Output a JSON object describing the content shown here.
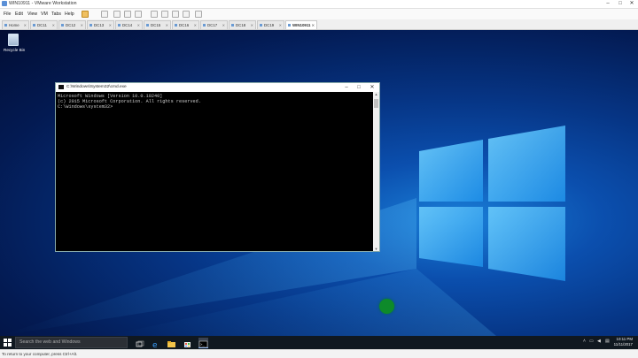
{
  "window": {
    "title": "WIN10911 - VMware Workstation",
    "controls": [
      "–",
      "□",
      "✕"
    ]
  },
  "menu": {
    "items": [
      "File",
      "Edit",
      "View",
      "VM",
      "Tabs",
      "Help"
    ]
  },
  "tabs": [
    {
      "label": "Home",
      "active": false
    },
    {
      "label": "DC11",
      "active": false
    },
    {
      "label": "DC12",
      "active": false
    },
    {
      "label": "DC13",
      "active": false
    },
    {
      "label": "DC14",
      "active": false
    },
    {
      "label": "DC15",
      "active": false
    },
    {
      "label": "DC16",
      "active": false
    },
    {
      "label": "DC17",
      "active": false
    },
    {
      "label": "DC18",
      "active": false
    },
    {
      "label": "DC19",
      "active": false
    },
    {
      "label": "WIN10911",
      "active": true
    }
  ],
  "desktop": {
    "recycle_bin_label": "Recycle Bin"
  },
  "cmd": {
    "title": "C:\\Windows\\System32\\cmd.exe",
    "lines": [
      "Microsoft Windows [Version 10.0.10240]",
      "(c) 2015 Microsoft Corporation. All rights reserved.",
      "",
      "C:\\Windows\\system32>"
    ]
  },
  "taskbar": {
    "search_placeholder": "Search the web and Windows",
    "time": "10:11 PM",
    "date": "11/11/2017"
  },
  "status_bar": {
    "text": "To return to your computer, press Ctrl+Alt."
  },
  "colors": {
    "desktop_blue": "#0b4fae",
    "taskbar": "#101820",
    "console_bg": "#000000"
  }
}
